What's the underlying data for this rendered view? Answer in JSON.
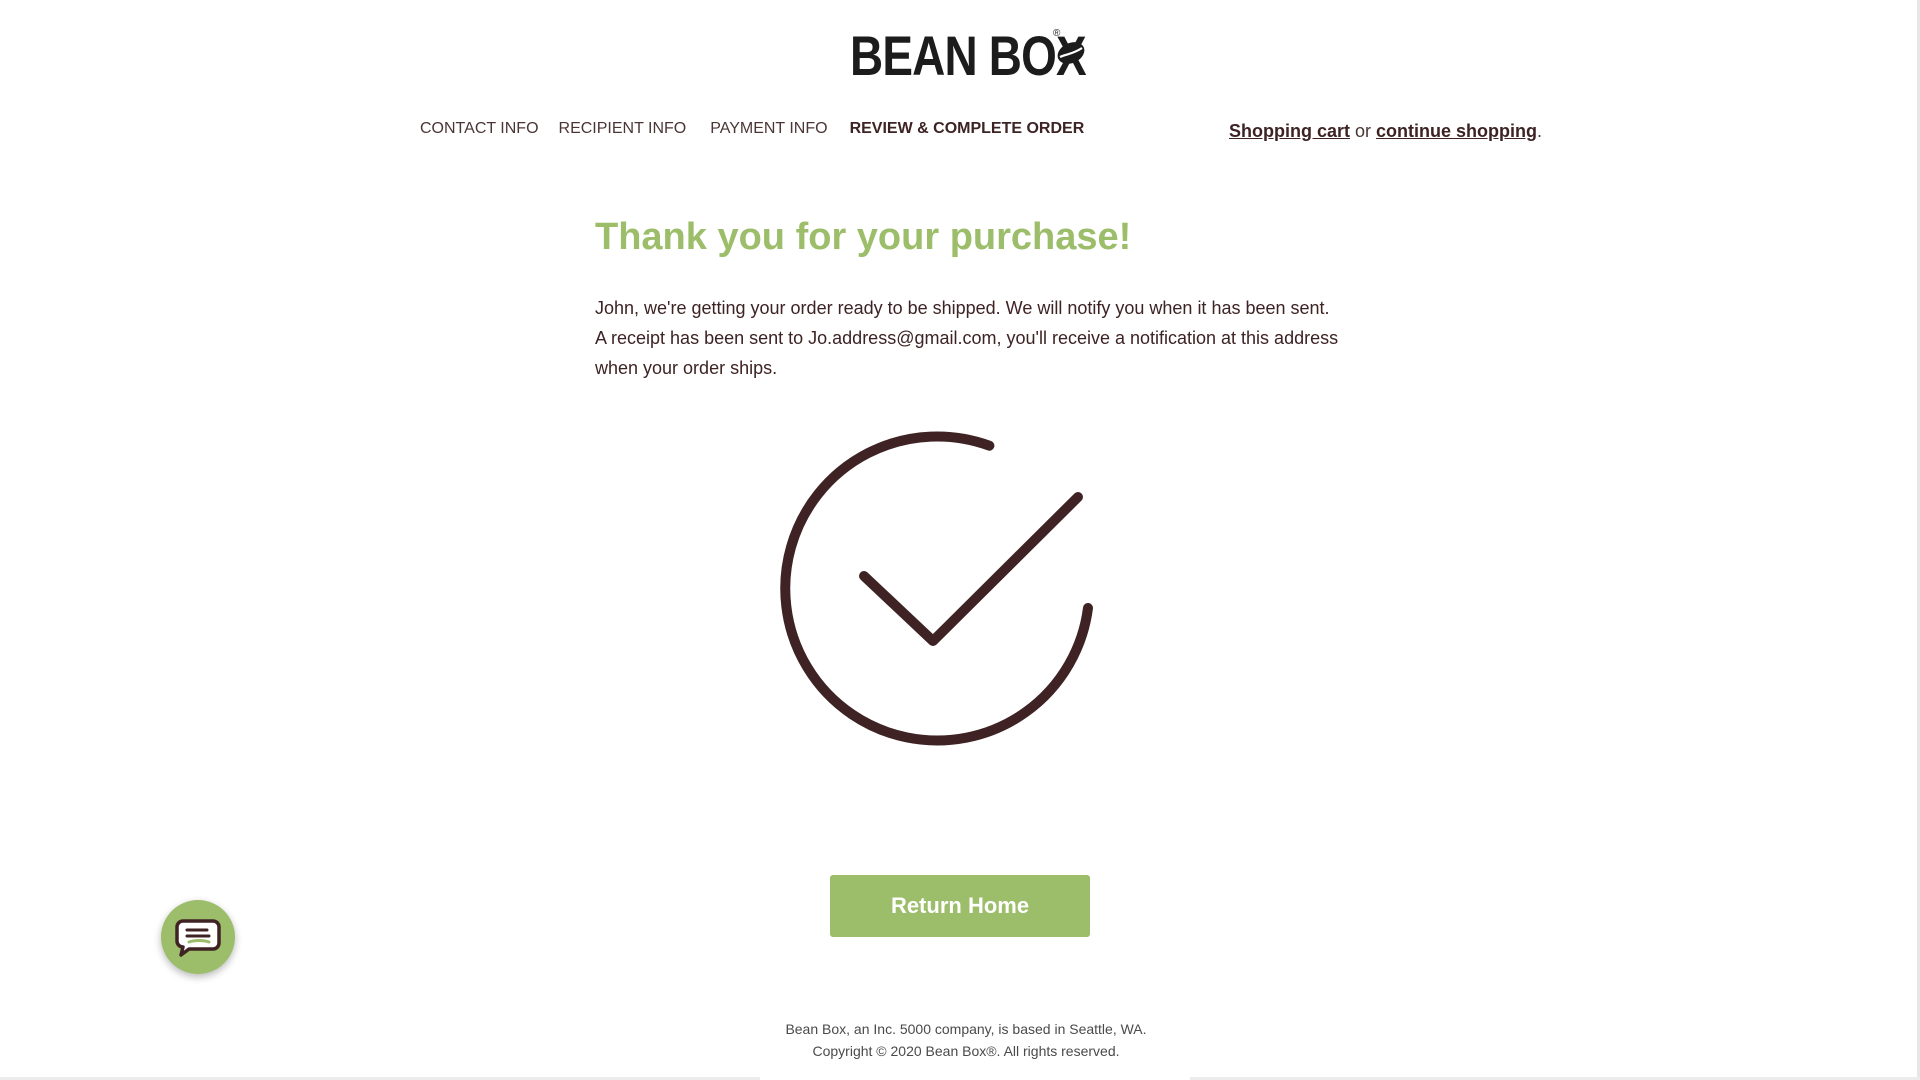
{
  "logo": {
    "text": "BEAN BOX",
    "reg_mark": "®"
  },
  "steps": [
    {
      "label": "CONTACT INFO",
      "active": false
    },
    {
      "label": "RECIPIENT INFO",
      "active": false
    },
    {
      "label": "PAYMENT INFO",
      "active": false
    },
    {
      "label": "REVIEW & COMPLETE ORDER",
      "active": true
    }
  ],
  "cart": {
    "cart_link": "Shopping cart",
    "or_text": " or ",
    "continue_link": "continue shopping",
    "period": "."
  },
  "confirmation": {
    "headline": "Thank you for your purchase!",
    "line1": "John, we're getting your order ready to be shipped. We will notify you when it has been sent.",
    "line2": "A receipt has been sent to Jo.address@gmail.com, you'll receive a notification at this address when your order ships."
  },
  "return_button": "Return Home",
  "footer": {
    "line1": "Bean Box, an Inc. 5000 company, is based in Seattle, WA.",
    "line2": "Copyright © 2020 Bean Box®. All rights reserved."
  },
  "colors": {
    "accent_green": "#9cbd69",
    "dark_brown": "#3d2323"
  },
  "icons": {
    "check": "check-circle-icon",
    "chat": "chat-bubble-icon",
    "bean": "coffee-bean-icon"
  }
}
